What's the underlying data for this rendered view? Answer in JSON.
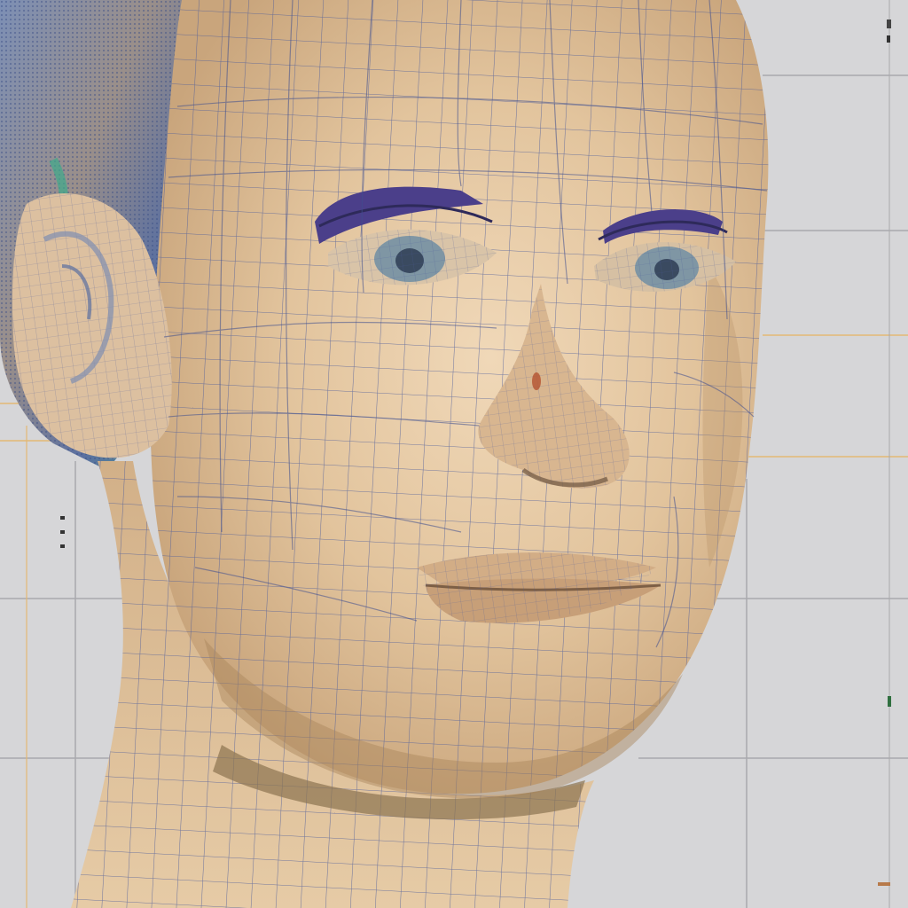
{
  "scene": {
    "subject": "wireframe-head-render",
    "colors": {
      "background": "#d6d6d8",
      "guide_gray": "#a9a9ad",
      "guide_orange": "#e3b874",
      "skin_light": "#ecd2b0",
      "skin_mid": "#d9b88f",
      "skin_shadow": "#a8845c",
      "hair_blue": "#6f7fa8",
      "hair_green": "#4aa48e",
      "hair_warm": "#b08a6a",
      "mesh_line": "#4a5a9a",
      "eye_purple": "#4b3f8a",
      "iris": "#7f96a4"
    }
  }
}
